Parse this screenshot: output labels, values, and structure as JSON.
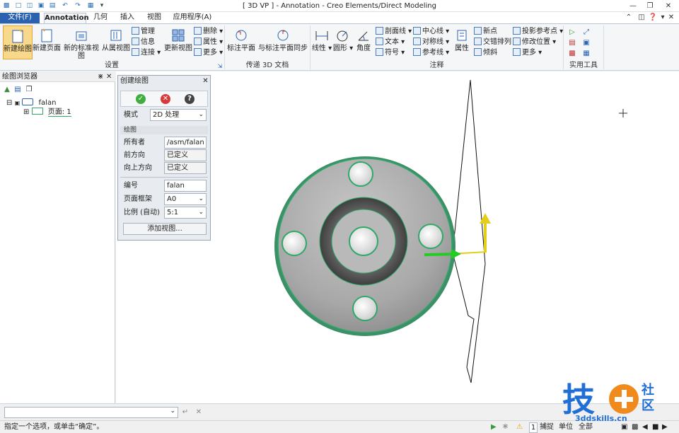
{
  "window": {
    "title": "[ 3D VP ] - Annotation - Creo Elements/Direct Modeling",
    "minimize": "—",
    "restore": "❐",
    "close": "✕"
  },
  "tabs": [
    "文件(F)",
    "Annotation",
    "几何",
    "插入",
    "视图",
    "应用程序(A)"
  ],
  "ribbon": {
    "groups": {
      "settings": "设置",
      "transfer": "传递 3D 文档",
      "annotation": "注释",
      "utilities": "实用工具"
    },
    "buttons": {
      "new_drawing": "新建绘图",
      "new_page": "新建页面",
      "new_std_view": "新的标准视图",
      "from_view": "从属视图",
      "manage": "管理",
      "info": "信息",
      "connect": "连接",
      "update_view": "更新视图",
      "delete": "删除",
      "properties": "属性",
      "more": "更多",
      "dim_plane": "标注平面",
      "sync_dim_plane": "与标注平面同步",
      "linear": "线性",
      "circle": "圆形",
      "angle": "角度",
      "section_line": "剖面线",
      "text": "文本",
      "symbol": "符号",
      "center_line": "中心线",
      "symmetry_line": "对称线",
      "ref_line": "参考线",
      "attr": "属性",
      "new_point": "新点",
      "stagger": "交错排列",
      "tilt": "倾斜",
      "proj_ref_point": "投影参考点",
      "modify_pos": "修改位置",
      "more2": "更多"
    }
  },
  "browser": {
    "title": "绘图浏览器",
    "root": "falan",
    "page": "页面: 1"
  },
  "dialog": {
    "title": "创建绘图",
    "help": "?",
    "mode_label": "模式",
    "mode_value": "2D 处理",
    "section_drawing": "绘图",
    "owner_label": "所有者",
    "owner_value": "/asm/falan",
    "front_label": "前方向",
    "front_value": "已定义",
    "up_label": "向上方向",
    "up_value": "已定义",
    "number_label": "编号",
    "number_value": "falan",
    "frame_label": "页面框架",
    "frame_value": "A0",
    "scale_label": "比例 (自动)",
    "scale_value": "5:1",
    "add_view": "添加视图..."
  },
  "status": {
    "prompt": "指定一个选项，或单击“确定”。",
    "count": "1",
    "snap": "捕捉",
    "unit": "单位",
    "all": "全部"
  },
  "watermark": {
    "char1": "技",
    "char2": "社",
    "char3": "区",
    "url": "3ddskills.cn"
  },
  "colors": {
    "accent": "#2a62b0",
    "part_edge": "#2fa86a",
    "axis_green": "#22cc22",
    "axis_yellow": "#e3cf1a",
    "watermark_blue": "#1f6fd6",
    "watermark_orange": "#f08a1c"
  }
}
